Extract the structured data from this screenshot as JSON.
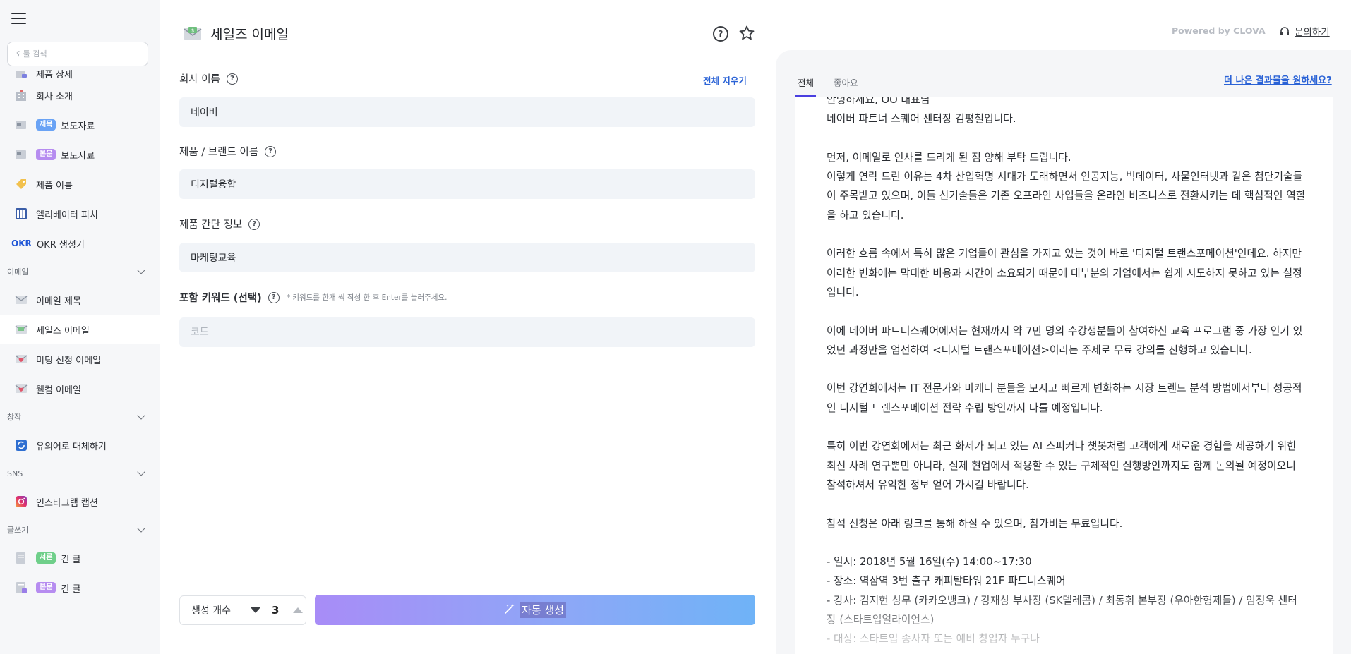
{
  "sidebar": {
    "search_placeholder": "툴 검색",
    "items_top": [
      {
        "label": "제품 상세",
        "badge": ""
      },
      {
        "label": "회사 소개",
        "badge": ""
      },
      {
        "label": "보도자료",
        "badge": "제목"
      },
      {
        "label": "보도자료",
        "badge": "본문"
      },
      {
        "label": "제품 이름",
        "badge": ""
      },
      {
        "label": "엘리베이터 피치",
        "badge": ""
      },
      {
        "label": "OKR 생성기",
        "prefix": "OKR"
      }
    ],
    "group_email": "이메일",
    "items_email": [
      "이메일 제목",
      "세일즈 이메일",
      "미팅 신청 이메일",
      "웰컴 이메일"
    ],
    "group_create": "창작",
    "items_create": [
      "유의어로 대체하기"
    ],
    "group_sns": "SNS",
    "items_sns": [
      "인스타그램 캡션"
    ],
    "group_writing": "글쓰기",
    "items_writing": [
      {
        "badge": "서론",
        "label": "긴 글"
      },
      {
        "badge": "본문",
        "label": "긴 글"
      }
    ]
  },
  "main": {
    "title": "세일즈 이메일",
    "clear_all": "전체 지우기",
    "fields": [
      {
        "label": "회사 이름",
        "value": "네이버"
      },
      {
        "label": "제품 / 브랜드 이름",
        "value": "디지털융합"
      },
      {
        "label": "제품 간단 정보",
        "value": "마케팅교육"
      }
    ],
    "keyword_label": "포함 키워드 (선택)",
    "keyword_hint": "* 키워드를 한개 씩 작성 한 후 Enter를 눌러주세요.",
    "keyword_placeholder": "코드",
    "count_label": "생성 개수",
    "count_value": "3",
    "generate_label": "자동 생성"
  },
  "result": {
    "powered_by": "Powered by CLOVA",
    "contact": "문의하기",
    "tabs": [
      "전체",
      "좋아요"
    ],
    "better_link": "더 나은 결과물을 원하세요?",
    "text": "안녕하세요, OO 대표님\n네이버 파트너 스퀘어 센터장 김평철입니다.\n\n먼저, 이메일로 인사를 드리게 된 점 양해 부탁 드립니다.\n이렇게 연락 드린 이유는 4차 산업혁명 시대가 도래하면서 인공지능, 빅데이터, 사물인터넷과 같은 첨단기술들이 주목받고 있으며, 이들 신기술들은 기존 오프라인 사업들을 온라인 비즈니스로 전환시키는 데 핵심적인 역할을 하고 있습니다.\n\n이러한 흐름 속에서 특히 많은 기업들이 관심을 가지고 있는 것이 바로 '디지털 트랜스포메이션'인데요. 하지만 이러한 변화에는 막대한 비용과 시간이 소요되기 때문에 대부분의 기업에서는 쉽게 시도하지 못하고 있는 실정입니다.\n\n이에 네이버 파트너스퀘어에서는 현재까지 약 7만 명의 수강생분들이 참여하신 교육 프로그램 중 가장 인기 있었던 과정만을 엄선하여 <디지털 트랜스포메이션>이라는 주제로 무료 강의를 진행하고 있습니다.\n\n이번 강연회에서는 IT 전문가와 마케터 분들을 모시고 빠르게 변화하는 시장 트렌드 분석 방법에서부터 성공적인 디지털 트랜스포메이션 전략 수립 방안까지 다룰 예정입니다.\n\n특히 이번 강연회에서는 최근 화제가 되고 있는 AI 스피커나 챗봇처럼 고객에게 새로운 경험을 제공하기 위한 최신 사례 연구뿐만 아니라, 실제 현업에서 적용할 수 있는 구체적인 실행방안까지도 함께 논의될 예정이오니 참석하셔서 유익한 정보 얻어 가시길 바랍니다.\n\n참석 신청은 아래 링크를 통해 하실 수 있으며, 참가비는 무료입니다.\n\n- 일시: 2018년 5월 16일(수) 14:00~17:30\n- 장소: 역삼역 3번 출구 캐피탈타워 21F 파트너스퀘어\n- 강사: 김지현 상무 (카카오뱅크) / 강재상 부사장 (SK텔레콤) / 최동휘 본부장 (우아한형제들) / 임정욱 센터장 (스타트업얼라이언스)\n- 대상: 스타트업 종사자 또는 예비 창업자 누구나"
  },
  "colors": {
    "accent_blue": "#2b63d6",
    "tab_underline": "#4a3fe0",
    "button_gradient_start": "#a88cf7",
    "button_gradient_end": "#6fb3f7"
  }
}
